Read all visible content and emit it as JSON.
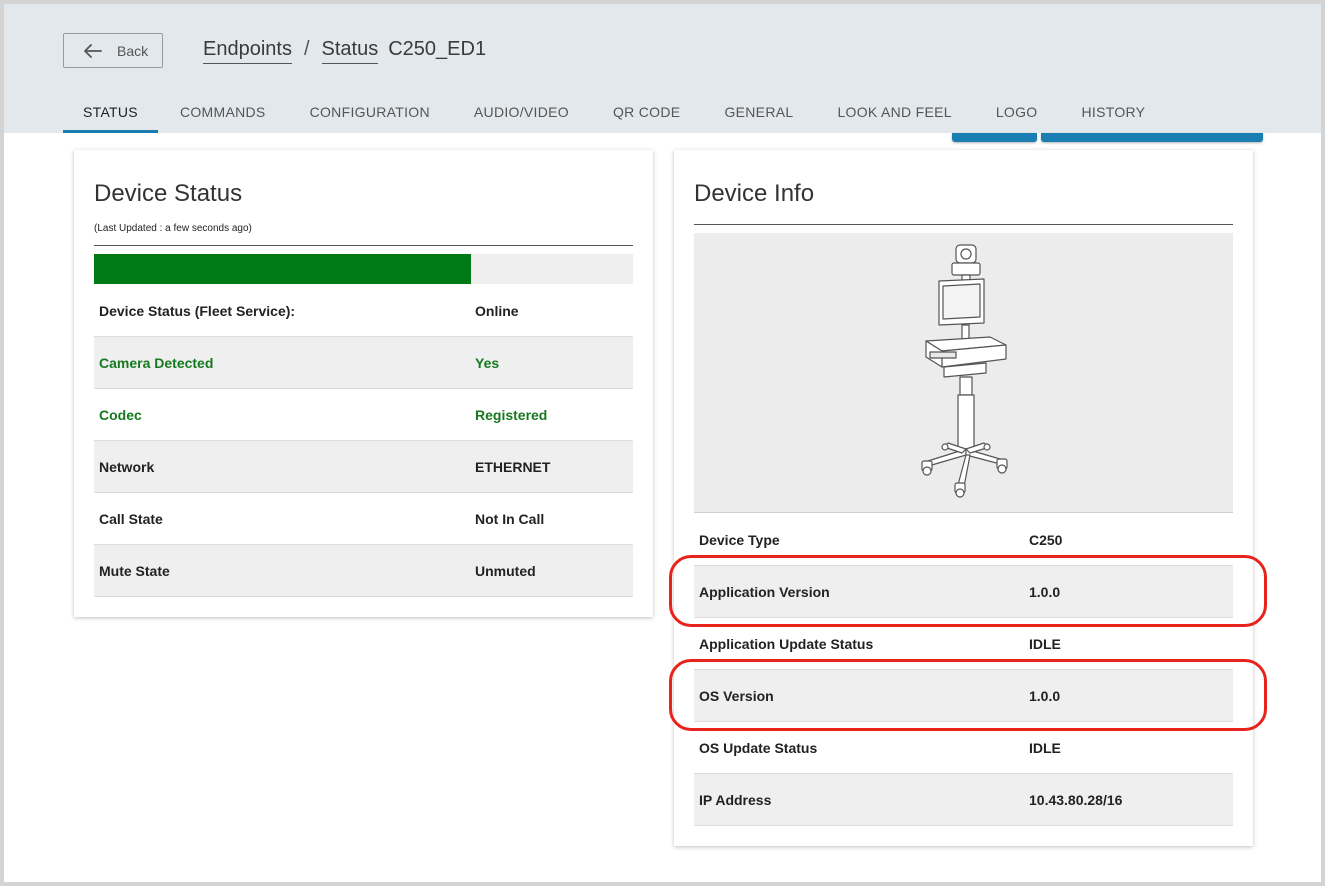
{
  "header": {
    "back_label": "Back",
    "breadcrumb": {
      "endpoints": "Endpoints",
      "status": "Status",
      "current": "C250_ED1"
    }
  },
  "tabs": [
    {
      "label": "STATUS",
      "active": true
    },
    {
      "label": "COMMANDS"
    },
    {
      "label": "CONFIGURATION"
    },
    {
      "label": "AUDIO/VIDEO"
    },
    {
      "label": "QR CODE"
    },
    {
      "label": "GENERAL"
    },
    {
      "label": "LOOK AND FEEL"
    },
    {
      "label": "LOGO"
    },
    {
      "label": "HISTORY"
    }
  ],
  "device_status": {
    "title": "Device Status",
    "last_updated": "(Last Updated : a few seconds ago)",
    "progress_fraction": 0.7,
    "progress_color": "#007a14",
    "rows": [
      {
        "label": "Device Status (Fleet Service):",
        "value": "Online"
      },
      {
        "label": "Camera Detected",
        "value": "Yes",
        "status": "green"
      },
      {
        "label": "Codec",
        "value": "Registered",
        "status": "green"
      },
      {
        "label": "Network",
        "value": "ETHERNET"
      },
      {
        "label": "Call State",
        "value": "Not In Call"
      },
      {
        "label": "Mute State",
        "value": "Unmuted"
      }
    ]
  },
  "device_info": {
    "title": "Device Info",
    "image_icon": "telehealth-cart-icon",
    "rows": [
      {
        "label": "Device Type",
        "value": "C250"
      },
      {
        "label": "Application Version",
        "value": "1.0.0",
        "highlighted": true
      },
      {
        "label": "Application Update Status",
        "value": "IDLE"
      },
      {
        "label": "OS Version",
        "value": "1.0.0",
        "highlighted": true
      },
      {
        "label": "OS Update Status",
        "value": "IDLE"
      },
      {
        "label": "IP Address",
        "value": "10.43.80.28/16"
      }
    ]
  },
  "colors": {
    "accent": "#1a7eb2",
    "success_green": "#17791f",
    "highlight_red": "#e8231b",
    "header_bg": "#e3e8ec"
  }
}
